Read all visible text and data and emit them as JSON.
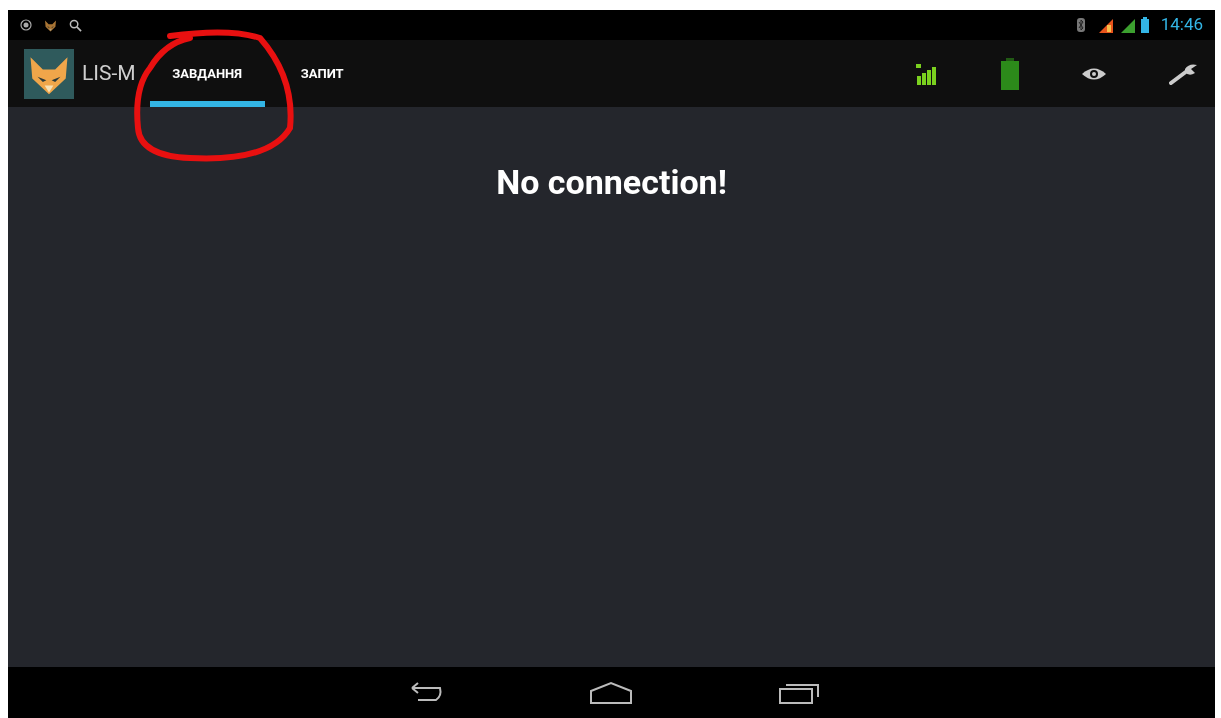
{
  "status_bar": {
    "time": "14:46"
  },
  "action_bar": {
    "title": "LIS-M",
    "tabs": [
      {
        "label": "ЗАВДАННЯ",
        "selected": true
      },
      {
        "label": "ЗАПИТ",
        "selected": false
      }
    ]
  },
  "content": {
    "message": "No connection!"
  }
}
